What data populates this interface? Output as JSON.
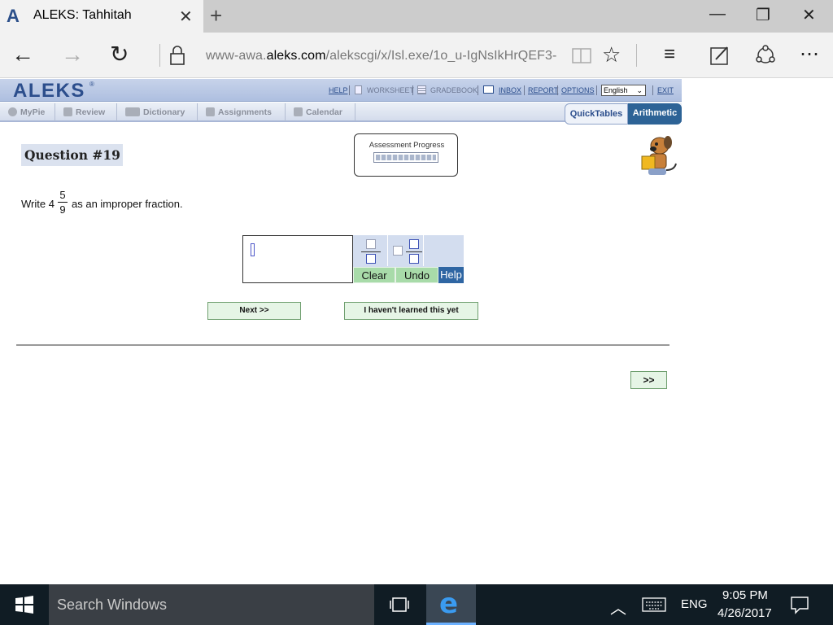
{
  "browser": {
    "tab_title": "ALEKS: Tahhitah",
    "tab_logo": "A",
    "url_prefix": "www-awa.",
    "url_domain": "aleks.com",
    "url_path": "/alekscgi/x/Isl.exe/1o_u-IgNsIkHrQEF3-",
    "icons": [
      "back-icon",
      "forward-icon",
      "refresh-icon",
      "lock-icon",
      "reading-view-icon",
      "favorite-star-icon",
      "hub-icon",
      "web-note-icon",
      "share-icon",
      "more-icon"
    ]
  },
  "aleks_header": {
    "logo": "ALEKS",
    "links": {
      "help": "HELP",
      "worksheet": "WORKSHEET",
      "gradebook": "GRADEBOOK",
      "inbox": "INBOX",
      "report": "REPORT",
      "options": "OPTIONS",
      "exit": "EXIT"
    },
    "language": "English"
  },
  "aleks_nav": {
    "tabs": [
      "MyPie",
      "Review",
      "Dictionary",
      "Assignments",
      "Calendar"
    ],
    "quicktables": "QuickTables",
    "subject": "Arithmetic"
  },
  "question": {
    "title": "Question #19",
    "prompt_before": "Write 4",
    "frac_num": "5",
    "frac_den": "9",
    "prompt_after": "as an improper fraction."
  },
  "progress": {
    "label": "Assessment Progress",
    "fraction": 1.0
  },
  "editor": {
    "clear": "Clear",
    "undo": "Undo",
    "help": "Help"
  },
  "buttons": {
    "next": "Next >>",
    "havent_learned": "I haven't learned this yet",
    "forward": ">>"
  },
  "taskbar": {
    "search_placeholder": "Search Windows",
    "language": "ENG",
    "time": "9:05 PM",
    "date": "4/26/2017"
  },
  "colors": {
    "aleks_blue": "#2c4e8c",
    "arithmetic_tab": "#2d6396",
    "editor_green": "#a8dba9",
    "taskbar": "#101c24"
  }
}
